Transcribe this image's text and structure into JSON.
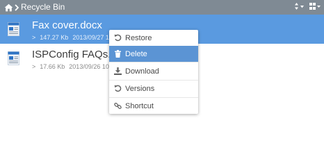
{
  "toolbar": {
    "breadcrumb_label": "Recycle Bin",
    "icons": {
      "home": "home-icon",
      "chevron": "chevron-right-icon",
      "sort": "sort-icon",
      "view": "grid-view-icon"
    }
  },
  "files": [
    {
      "name": "Fax cover.docx",
      "size": "147.27 Kb",
      "date": "2013/09/27 1",
      "selected": true
    },
    {
      "name": "ISPConfig FAQs.",
      "size": "17.66 Kb",
      "date": "2013/09/26 10",
      "selected": false
    }
  ],
  "context_menu": {
    "items": [
      {
        "label": "Restore",
        "icon": "restore-icon"
      },
      {
        "label": "Delete",
        "icon": "trash-icon",
        "active": true
      },
      {
        "label": "Download",
        "icon": "download-icon"
      },
      {
        "label": "Versions",
        "icon": "versions-icon"
      },
      {
        "label": "Shortcut",
        "icon": "link-icon"
      }
    ]
  },
  "colors": {
    "topbar": "#7f8a94",
    "selected_row": "#5a9ae0",
    "menu_active": "#5b94d4"
  }
}
